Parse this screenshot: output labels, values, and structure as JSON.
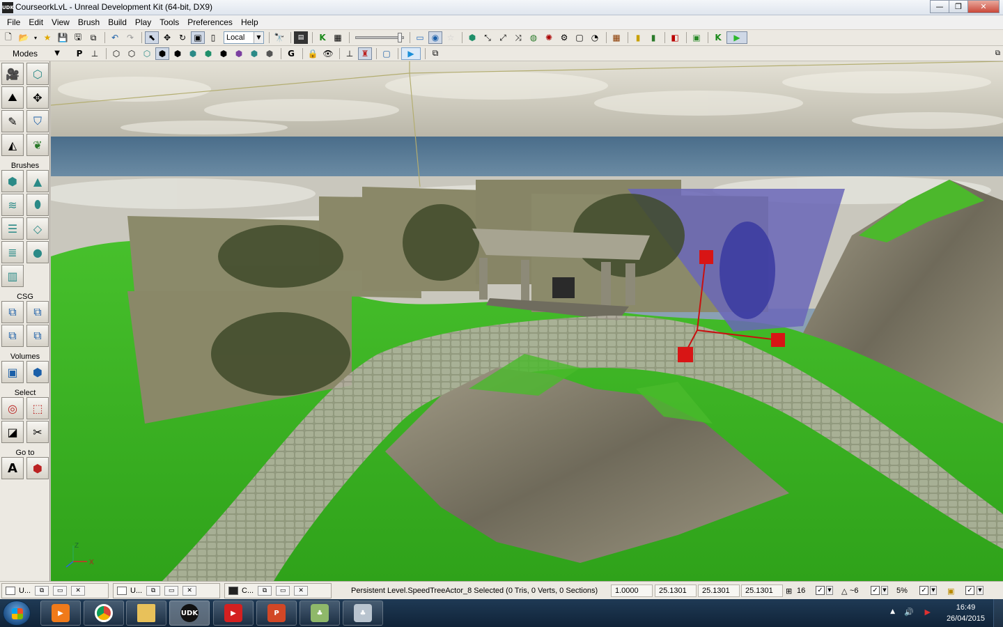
{
  "window": {
    "title": "CourseorkLvL - Unreal Development Kit (64-bit, DX9)",
    "app_icon_text": "UDK",
    "buttons": {
      "minimize": "—",
      "maximize": "❐",
      "close": "✕"
    }
  },
  "menu": [
    "File",
    "Edit",
    "View",
    "Brush",
    "Build",
    "Play",
    "Tools",
    "Preferences",
    "Help"
  ],
  "toolbar": {
    "coordinate_system": "Local",
    "play_icon": "play-in-editor-icon"
  },
  "modes_panel": {
    "modes_label": "Modes",
    "sections": {
      "brushes": "Brushes",
      "csg": "CSG",
      "volumes": "Volumes",
      "select": "Select",
      "goto": "Go to"
    },
    "goto_actor_glyph": "A"
  },
  "viewport": {
    "axis_z": "Z",
    "axis_x": "X",
    "colors": {
      "sky_top": "#d6d3c6",
      "sea": "#4f7391",
      "grass": "#3bb524",
      "rock": "#8c8774",
      "gizmo": "#d81515"
    }
  },
  "statusbar": {
    "windows": [
      {
        "label": "U..."
      },
      {
        "label": "U..."
      },
      {
        "label": "C..."
      }
    ],
    "selection": "Persistent Level.SpeedTreeActor_8 Selected (0 Tris, 0 Verts, 0 Sections)",
    "scale": "1.0000",
    "drag_x": "25.1301",
    "drag_y": "25.1301",
    "drag_z": "25.1301",
    "grid_size": "16",
    "rotation_grid": "~6",
    "scale_grid": "5%"
  },
  "taskbar": {
    "apps": [
      "Windows Media Player",
      "Google Chrome",
      "Windows Explorer",
      "UDK",
      "PlayStation",
      "PowerPoint",
      "SpeedTree",
      "SpeedTree Modeler"
    ],
    "udk_label": "UDK",
    "time": "16:49",
    "date": "26/04/2015"
  }
}
